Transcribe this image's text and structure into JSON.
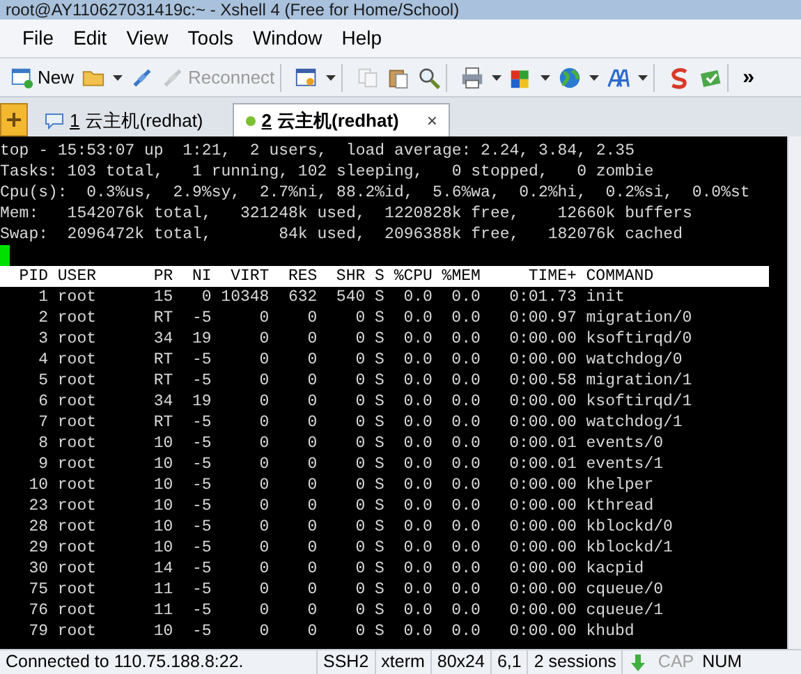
{
  "window": {
    "title": "root@AY110627031419c:~ - Xshell 4 (Free for Home/School)"
  },
  "menu": [
    "File",
    "Edit",
    "View",
    "Tools",
    "Window",
    "Help"
  ],
  "toolbar": [
    [
      {
        "kind": "new",
        "label": "New"
      },
      {
        "kind": "open",
        "dropdown": true
      },
      {
        "kind": "connect"
      },
      {
        "kind": "reconnect",
        "label": "Reconnect",
        "disabled": true
      }
    ],
    [
      {
        "kind": "properties",
        "dropdown": true
      }
    ],
    [
      {
        "kind": "copy",
        "disabled": true
      },
      {
        "kind": "paste"
      },
      {
        "kind": "find"
      }
    ],
    [
      {
        "kind": "print",
        "dropdown": true
      },
      {
        "kind": "colors",
        "dropdown": true
      },
      {
        "kind": "globe",
        "dropdown": true
      },
      {
        "kind": "font",
        "dropdown": true
      }
    ],
    [
      {
        "kind": "logo"
      },
      {
        "kind": "transfer"
      }
    ],
    [
      {
        "kind": "more",
        "label": "»"
      }
    ]
  ],
  "tabs": [
    {
      "number": "1",
      "label": "云主机(redhat)",
      "selected": false
    },
    {
      "number": "2",
      "label": "云主机(redhat)",
      "selected": true
    }
  ],
  "close_glyph": "×",
  "terminal": {
    "summary": [
      "top - 15:53:07 up  1:21,  2 users,  load average: 2.24, 3.84, 2.35",
      "Tasks: 103 total,   1 running, 102 sleeping,   0 stopped,   0 zombie",
      "Cpu(s):  0.3%us,  2.9%sy,  2.7%ni, 88.2%id,  5.6%wa,  0.2%hi,  0.2%si,  0.0%st",
      "Mem:   1542076k total,   321248k used,  1220828k free,    12660k buffers",
      "Swap:  2096472k total,       84k used,  2096388k free,   182076k cached"
    ],
    "columns": [
      "PID",
      "USER",
      "PR",
      "NI",
      "VIRT",
      "RES",
      "SHR",
      "S",
      "%CPU",
      "%MEM",
      "TIME+",
      "COMMAND"
    ],
    "rows": [
      [
        "1",
        "root",
        "15",
        "0",
        "10348",
        "632",
        "540",
        "S",
        "0.0",
        "0.0",
        "0:01.73",
        "init"
      ],
      [
        "2",
        "root",
        "RT",
        "-5",
        "0",
        "0",
        "0",
        "S",
        "0.0",
        "0.0",
        "0:00.97",
        "migration/0"
      ],
      [
        "3",
        "root",
        "34",
        "19",
        "0",
        "0",
        "0",
        "S",
        "0.0",
        "0.0",
        "0:00.00",
        "ksoftirqd/0"
      ],
      [
        "4",
        "root",
        "RT",
        "-5",
        "0",
        "0",
        "0",
        "S",
        "0.0",
        "0.0",
        "0:00.00",
        "watchdog/0"
      ],
      [
        "5",
        "root",
        "RT",
        "-5",
        "0",
        "0",
        "0",
        "S",
        "0.0",
        "0.0",
        "0:00.58",
        "migration/1"
      ],
      [
        "6",
        "root",
        "34",
        "19",
        "0",
        "0",
        "0",
        "S",
        "0.0",
        "0.0",
        "0:00.00",
        "ksoftirqd/1"
      ],
      [
        "7",
        "root",
        "RT",
        "-5",
        "0",
        "0",
        "0",
        "S",
        "0.0",
        "0.0",
        "0:00.00",
        "watchdog/1"
      ],
      [
        "8",
        "root",
        "10",
        "-5",
        "0",
        "0",
        "0",
        "S",
        "0.0",
        "0.0",
        "0:00.01",
        "events/0"
      ],
      [
        "9",
        "root",
        "10",
        "-5",
        "0",
        "0",
        "0",
        "S",
        "0.0",
        "0.0",
        "0:00.01",
        "events/1"
      ],
      [
        "10",
        "root",
        "10",
        "-5",
        "0",
        "0",
        "0",
        "S",
        "0.0",
        "0.0",
        "0:00.00",
        "khelper"
      ],
      [
        "23",
        "root",
        "10",
        "-5",
        "0",
        "0",
        "0",
        "S",
        "0.0",
        "0.0",
        "0:00.00",
        "kthread"
      ],
      [
        "28",
        "root",
        "10",
        "-5",
        "0",
        "0",
        "0",
        "S",
        "0.0",
        "0.0",
        "0:00.00",
        "kblockd/0"
      ],
      [
        "29",
        "root",
        "10",
        "-5",
        "0",
        "0",
        "0",
        "S",
        "0.0",
        "0.0",
        "0:00.00",
        "kblockd/1"
      ],
      [
        "30",
        "root",
        "14",
        "-5",
        "0",
        "0",
        "0",
        "S",
        "0.0",
        "0.0",
        "0:00.00",
        "kacpid"
      ],
      [
        "75",
        "root",
        "11",
        "-5",
        "0",
        "0",
        "0",
        "S",
        "0.0",
        "0.0",
        "0:00.00",
        "cqueue/0"
      ],
      [
        "76",
        "root",
        "11",
        "-5",
        "0",
        "0",
        "0",
        "S",
        "0.0",
        "0.0",
        "0:00.00",
        "cqueue/1"
      ],
      [
        "79",
        "root",
        "10",
        "-5",
        "0",
        "0",
        "0",
        "S",
        "0.0",
        "0.0",
        "0:00.00",
        "khubd"
      ]
    ]
  },
  "status_bar": {
    "items": [
      "Connected to 110.75.188.8:22.",
      "SSH2",
      "xterm",
      "80x24",
      "6,1",
      "2 sessions"
    ],
    "indicators": [
      {
        "label": "CAP",
        "on": false
      },
      {
        "label": "NUM",
        "on": true
      }
    ]
  }
}
